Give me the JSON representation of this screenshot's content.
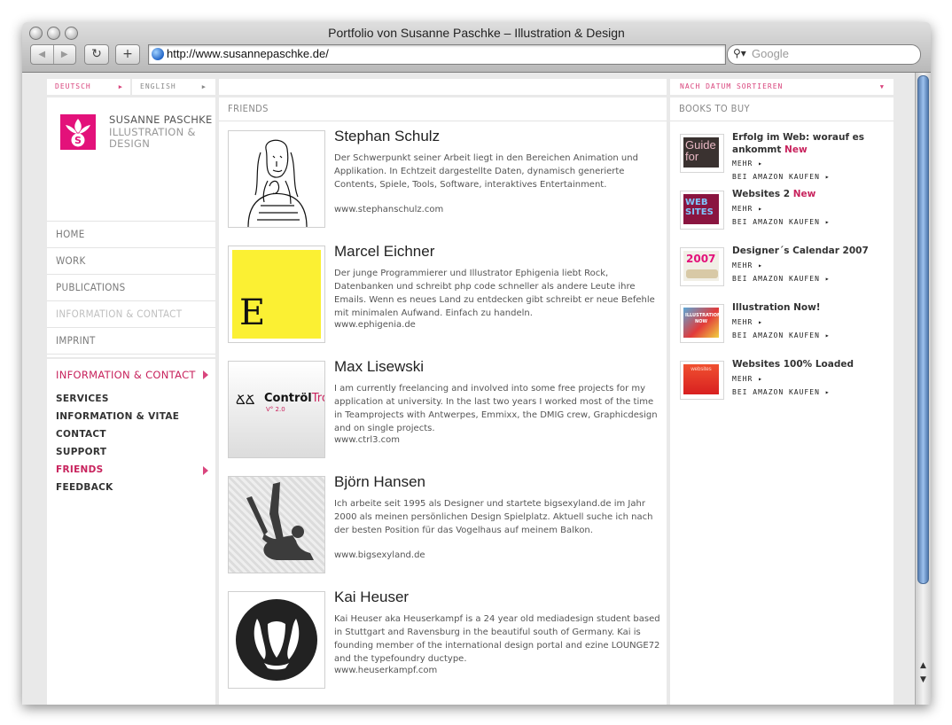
{
  "window": {
    "title": "Portfolio von Susanne Paschke – Illustration & Design"
  },
  "toolbar": {
    "back_icon": "◀",
    "forward_icon": "▶",
    "reload_icon": "↻",
    "add_icon": "+",
    "url": "http://www.susannepaschke.de/",
    "search_placeholder": "Google"
  },
  "language": {
    "de_label": "DEUTSCH",
    "en_label": "ENGLISH",
    "arrow": "▶"
  },
  "brand": {
    "line1": "SUSANNE PASCHKE",
    "line2": "ILLUSTRATION &",
    "line3": "DESIGN"
  },
  "nav": {
    "items": [
      {
        "label": "HOME"
      },
      {
        "label": "WORK"
      },
      {
        "label": "PUBLICATIONS"
      },
      {
        "label": "INFORMATION & CONTACT"
      },
      {
        "label": "IMPRINT"
      }
    ]
  },
  "section": {
    "title": "INFORMATION & CONTACT",
    "subitems": [
      {
        "label": "SERVICES"
      },
      {
        "label": "INFORMATION & VITAE"
      },
      {
        "label": "CONTACT"
      },
      {
        "label": "SUPPORT"
      },
      {
        "label": "FRIENDS"
      },
      {
        "label": "FEEDBACK"
      }
    ]
  },
  "friends": {
    "heading": "FRIENDS",
    "items": [
      {
        "name": "Stephan Schulz",
        "desc": "Der Schwerpunkt seiner Arbeit liegt in den Bereichen Animation und Applikation. In Echtzeit dargestellte Daten, dynamisch generierte Contents, Spiele, Tools, Software, interaktives Entertainment.",
        "url": "www.stephanschulz.com"
      },
      {
        "name": "Marcel Eichner",
        "desc": "Der junge Programmierer und Illustrator Ephigenia liebt Rock, Datenbanken und schreibt php code schneller als andere Leute ihre Emails. Wenn es neues Land zu entdecken gibt schreibt er neue Befehle mit minimalen Aufwand. Einfach zu handeln.",
        "url": "www.ephigenia.de",
        "thumb_letter": "E"
      },
      {
        "name": "Max Lisewski",
        "desc": "I am currently freelancing and involved into some free projects for my application at university. In the last two years I worked most of the time in Teamprojects with Antwerpes, Emmixx, the DMIG crew, Graphicdesign and on single projects.",
        "url": "www.ctrl3.com",
        "thumb_text": "Contröl",
        "thumb_text2": "Troi",
        "thumb_version": "V° 2.0"
      },
      {
        "name": "Björn Hansen",
        "desc": "Ich arbeite seit 1995 als Designer und startete bigsexyland.de im Jahr 2000 als meinen persönlichen Design Spielplatz. Aktuell suche ich nach der besten Position für das Vogelhaus auf meinem Balkon.",
        "url": "www.bigsexyland.de"
      },
      {
        "name": "Kai Heuser",
        "desc": "Kai Heuser aka Heuserkampf is a 24 year old mediadesign student based in Stuttgart and Ravensburg in the beautiful south of Germany. Kai is founding member of the international design portal and ezine LOUNGE72 and the typefoundry ductype.",
        "url": "www.heuserkampf.com"
      }
    ]
  },
  "books": {
    "sort_label": "NACH DATUM SORTIEREN",
    "sort_arrow": "▼",
    "heading": "BOOKS TO BUY",
    "more_label": "MEHR ▸",
    "buy_label": "BEI AMAZON KAUFEN ▸",
    "new_label": "New",
    "items": [
      {
        "title": "Erfolg im Web: worauf es ankommt",
        "cover_text": "Guide for"
      },
      {
        "title": "Websites 2",
        "cover_text": "WEB SITES"
      },
      {
        "title": "Designer´s Calendar 2007",
        "cover_text": "2007"
      },
      {
        "title": "Illustration Now!",
        "cover_text": "ILLUSTRATION NOW"
      },
      {
        "title": "Websites 100% Loaded",
        "cover_text": "websites"
      }
    ]
  },
  "colors": {
    "accent": "#c8235d",
    "logo": "#e3117a",
    "link_pink": "#d9457d"
  }
}
